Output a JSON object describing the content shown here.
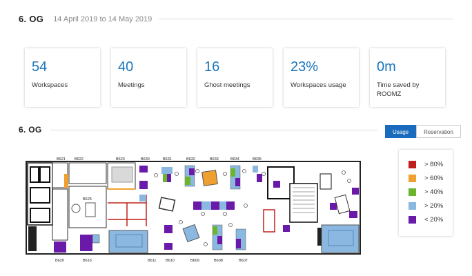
{
  "header": {
    "title": "6. OG",
    "date_range": "14 April 2019 to 14 May 2019"
  },
  "stats": [
    {
      "value": "54",
      "label": "Workspaces"
    },
    {
      "value": "40",
      "label": "Meetings"
    },
    {
      "value": "16",
      "label": "Ghost meetings"
    },
    {
      "value": "23%",
      "label": "Workspaces usage"
    },
    {
      "value": "0m",
      "label": "Time saved by ROOMZ"
    }
  ],
  "floor": {
    "title": "6. OG",
    "toggle": {
      "usage_label": "Usage",
      "reservation_label": "Reservation",
      "selected": "Usage"
    },
    "rooms_top": [
      "B621",
      "B622",
      "B623",
      "B630",
      "B631",
      "B632",
      "B633",
      "B634",
      "B635"
    ],
    "rooms_bottom": [
      "B620",
      "B616",
      "B611",
      "B610",
      "B609",
      "B608",
      "B607"
    ],
    "room_side": "B625"
  },
  "legend": {
    "items": [
      {
        "label": "> 80%",
        "color": "#c0201c"
      },
      {
        "label": "> 60%",
        "color": "#f0a030"
      },
      {
        "label": "> 40%",
        "color": "#6ab42e"
      },
      {
        "label": "> 20%",
        "color": "#8ab8e0"
      },
      {
        "label": "< 20%",
        "color": "#6a1aa8"
      }
    ]
  },
  "colors": {
    "accent": "#1a75bb",
    "toggle_active": "#1a6bbd"
  }
}
